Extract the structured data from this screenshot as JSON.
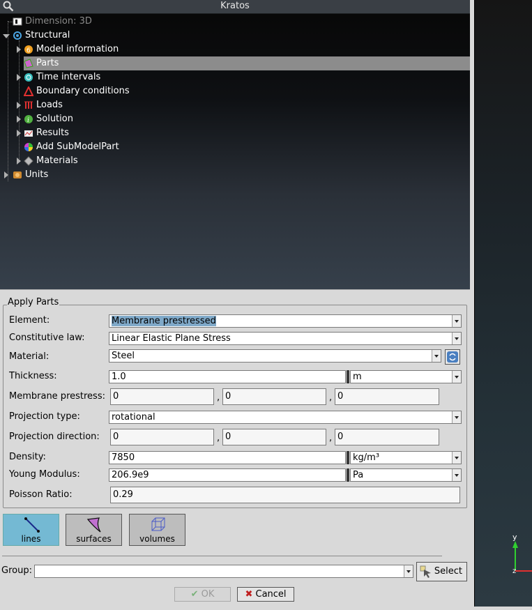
{
  "window": {
    "title": "Kratos"
  },
  "tree": {
    "dimension": "Dimension: 3D",
    "structural": "Structural",
    "items": [
      {
        "label": "Model information"
      },
      {
        "label": "Parts"
      },
      {
        "label": "Time intervals"
      },
      {
        "label": "Boundary conditions"
      },
      {
        "label": "Loads"
      },
      {
        "label": "Solution"
      },
      {
        "label": "Results"
      },
      {
        "label": "Add SubModelPart"
      },
      {
        "label": "Materials"
      }
    ],
    "units": "Units"
  },
  "form": {
    "legend": "Apply Parts",
    "element": {
      "label": "Element:",
      "value": "Membrane prestressed"
    },
    "constitutive": {
      "label": "Constitutive law:",
      "value": "Linear Elastic Plane Stress"
    },
    "material": {
      "label": "Material:",
      "value": "Steel"
    },
    "thickness": {
      "label": "Thickness:",
      "value": "1.0",
      "unit": "m"
    },
    "prestress": {
      "label": "Membrane prestress:",
      "v1": "0",
      "v2": "0",
      "v3": "0",
      "sep": ","
    },
    "projection_type": {
      "label": "Projection type:",
      "value": "rotational"
    },
    "projection_dir": {
      "label": "Projection direction:",
      "v1": "0",
      "v2": "0",
      "v3": "0"
    },
    "density": {
      "label": "Density:",
      "value": "7850",
      "unit": "kg/m³"
    },
    "young": {
      "label": "Young Modulus:",
      "value": "206.9e9",
      "unit": "Pa"
    },
    "poisson": {
      "label": "Poisson Ratio:",
      "value": "0.29"
    }
  },
  "entity_buttons": {
    "lines": "lines",
    "surfaces": "surfaces",
    "volumes": "volumes"
  },
  "group": {
    "label": "Group:",
    "value": "",
    "select": "Select"
  },
  "actions": {
    "ok": "OK",
    "cancel": "Cancel"
  },
  "axes": {
    "y": "y",
    "z": "z"
  },
  "colors": {
    "accent": "#74b9d3",
    "selection": "#8c8c8c",
    "highlight": "#7fa9c9"
  }
}
